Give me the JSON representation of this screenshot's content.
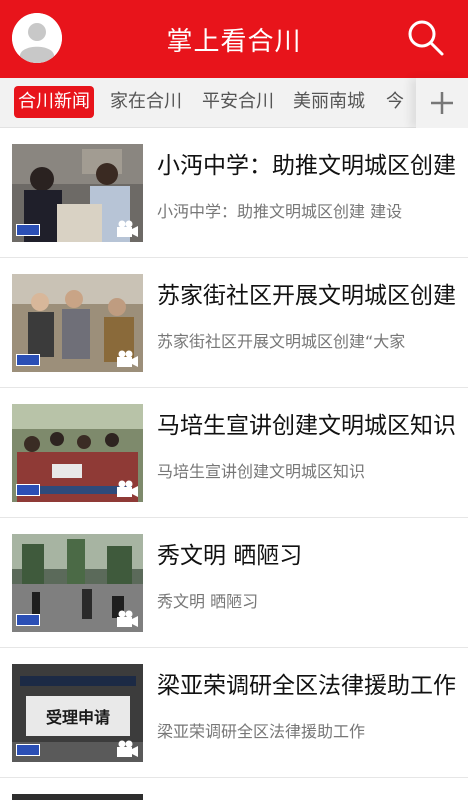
{
  "header": {
    "title": "掌上看合川",
    "avatar_icon": "user-avatar-icon",
    "search_icon": "search-icon",
    "background_color": "#e8141b"
  },
  "tabs": [
    {
      "label": "合川新闻",
      "active": true
    },
    {
      "label": "家在合川",
      "active": false
    },
    {
      "label": "平安合川",
      "active": false
    },
    {
      "label": "美丽南城",
      "active": false
    },
    {
      "label": "今",
      "active": false
    }
  ],
  "add_channel_icon": "plus-icon",
  "news": [
    {
      "title": "小沔中学：助推文明城区创建",
      "summary": "小沔中学：助推文明城区创建 建设"
    },
    {
      "title": "苏家街社区开展文明城区创建",
      "summary": "苏家街社区开展文明城区创建“大家"
    },
    {
      "title": "马培生宣讲创建文明城区知识",
      "summary": "马培生宣讲创建文明城区知识"
    },
    {
      "title": "秀文明 晒陋习",
      "summary": "秀文明 晒陋习"
    },
    {
      "title": "梁亚荣调研全区法律援助工作",
      "summary": "梁亚荣调研全区法律援助工作"
    }
  ],
  "thumbnail_sign_text": "受理申请",
  "accent_color": "#e8141b"
}
